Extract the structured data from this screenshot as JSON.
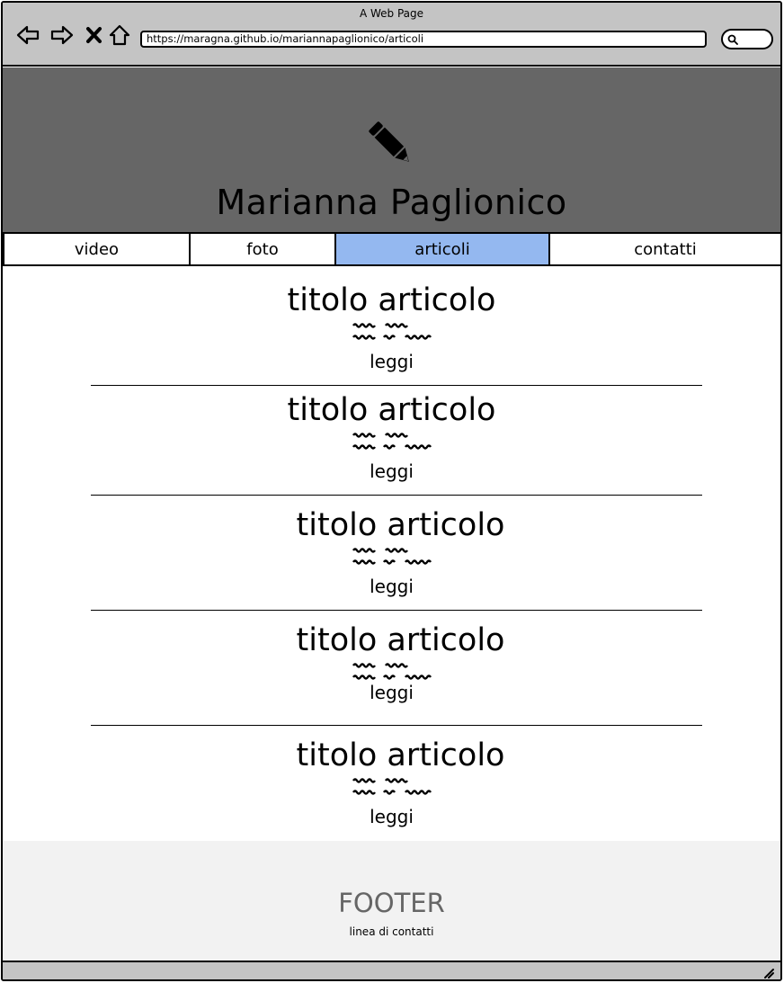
{
  "window": {
    "title": "A Web Page"
  },
  "toolbar": {
    "back_icon": "arrow-left-icon",
    "forward_icon": "arrow-right-icon",
    "stop_icon": "close-icon",
    "home_icon": "home-icon",
    "url": "https://maragna.github.io/mariannapaglionico/articoli",
    "search_icon": "search-icon"
  },
  "header": {
    "site_name": "Marianna Paglionico",
    "logo_icon": "pencil-icon",
    "bg_color": "#666666"
  },
  "menu": {
    "items": [
      {
        "label": "video",
        "active": false
      },
      {
        "label": "foto",
        "active": false
      },
      {
        "label": "articoli",
        "active": true
      },
      {
        "label": "contatti",
        "active": false
      }
    ],
    "active_color": "#94b8f0"
  },
  "articles": [
    {
      "title": "titolo articolo",
      "read_label": "leggi"
    },
    {
      "title": "titolo articolo",
      "read_label": "leggi"
    },
    {
      "title": "titolo articolo",
      "read_label": "leggi"
    },
    {
      "title": "titolo articolo",
      "read_label": "leggi"
    },
    {
      "title": "titolo articolo",
      "read_label": "leggi"
    }
  ],
  "footer": {
    "title": "FOOTER",
    "subtitle": "linea di contatti"
  }
}
